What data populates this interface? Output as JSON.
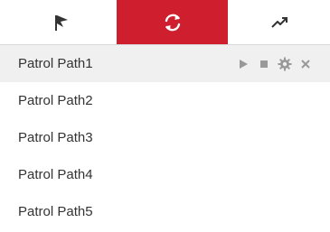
{
  "tabs": [
    {
      "icon": "flag-icon",
      "active": false
    },
    {
      "icon": "refresh-cycle-icon",
      "active": true
    },
    {
      "icon": "trend-arrow-icon",
      "active": false
    }
  ],
  "colors": {
    "accent": "#cf1e2e",
    "selected_row": "#f0f0f0",
    "text": "#333333",
    "icon": "#999999"
  },
  "patrol_paths": [
    {
      "label": "Patrol Path1",
      "selected": true
    },
    {
      "label": "Patrol Path2",
      "selected": false
    },
    {
      "label": "Patrol Path3",
      "selected": false
    },
    {
      "label": "Patrol Path4",
      "selected": false
    },
    {
      "label": "Patrol Path5",
      "selected": false
    }
  ],
  "row_actions": [
    "play-icon",
    "stop-icon",
    "settings-gear-icon",
    "delete-x-icon"
  ]
}
